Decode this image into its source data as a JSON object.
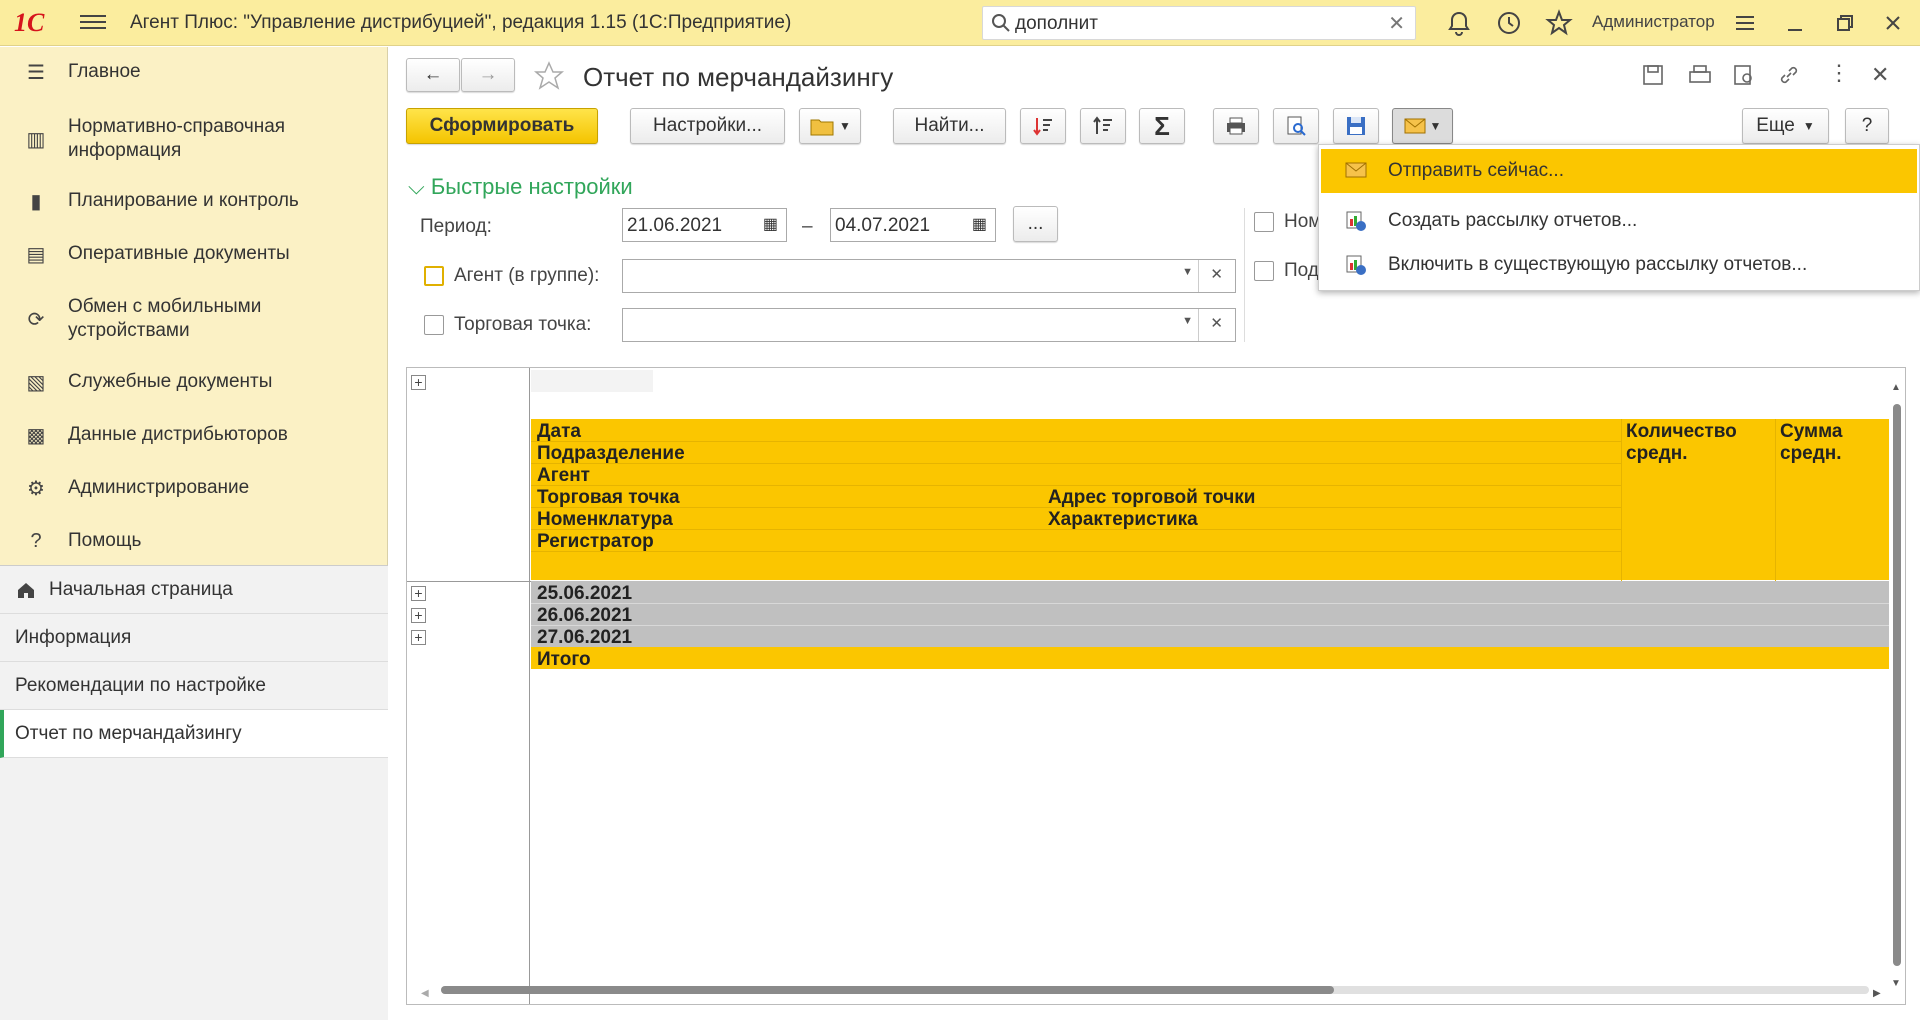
{
  "topbar": {
    "logo": "1С",
    "title": "Агент Плюс: \"Управление дистрибуцией\", редакция 1.15  (1С:Предприятие)",
    "search_value": "дополнит",
    "user": "Администратор"
  },
  "sidebar": {
    "items": [
      {
        "label": "Главное"
      },
      {
        "label": "Нормативно-справочная информация"
      },
      {
        "label": "Планирование и контроль"
      },
      {
        "label": "Оперативные документы"
      },
      {
        "label": "Обмен с мобильными устройствами"
      },
      {
        "label": "Служебные документы"
      },
      {
        "label": "Данные дистрибьюторов"
      },
      {
        "label": "Администрирование"
      },
      {
        "label": "Помощь"
      }
    ],
    "open_windows": [
      {
        "label": "Начальная страница"
      },
      {
        "label": "Информация"
      },
      {
        "label": "Рекомендации по настройке"
      },
      {
        "label": "Отчет по мерчандайзингу"
      }
    ]
  },
  "form": {
    "title": "Отчет по мерчандайзингу",
    "buttons": {
      "generate": "Сформировать",
      "settings": "Настройки...",
      "find": "Найти...",
      "more": "Еще",
      "help": "?"
    },
    "quick_settings": "Быстрые настройки",
    "period_label": "Период:",
    "date_from": "21.06.2021",
    "dash": "–",
    "date_to": "04.07.2021",
    "ellipsis": "...",
    "agent_label": "Агент (в группе):",
    "outlet_label": "Торговая точка:",
    "nom_label_partial": "Ном",
    "pod_label_partial": "Под"
  },
  "report": {
    "headers": {
      "date": "Дата",
      "division": "Подразделение",
      "agent": "Агент",
      "outlet": "Торговая точка",
      "outlet_address": "Адрес торговой точки",
      "nomenclature": "Номенклатура",
      "characteristic": "Характеристика",
      "registrar": "Регистратор",
      "qty_avg_1": "Количество",
      "qty_avg_2": "средн.",
      "sum_avg_1": "Сумма",
      "sum_avg_2": "средн."
    },
    "rows": [
      "25.06.2021",
      "26.06.2021",
      "27.06.2021"
    ],
    "total": "Итого"
  },
  "menu": {
    "items": [
      {
        "label": "Отправить сейчас..."
      },
      {
        "label": "Создать рассылку отчетов..."
      },
      {
        "label": "Включить в существующую рассылку отчетов..."
      }
    ]
  },
  "colors": {
    "topbar": "#fbed9e",
    "sidebar": "#fbf1c5",
    "report_header": "#fbc600",
    "report_row": "#c0c0c0",
    "accent_green": "#31a65a"
  }
}
